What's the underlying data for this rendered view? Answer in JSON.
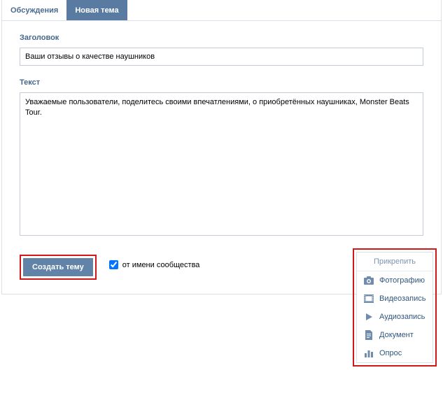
{
  "tabs": {
    "discussions": "Обсуждения",
    "new_topic": "Новая тема"
  },
  "form": {
    "title_label": "Заголовок",
    "title_value": "Ваши отзывы о качестве наушников",
    "text_label": "Текст",
    "text_value": "Уважаемые пользователи, поделитесь своими впечатлениями, о приобретённых наушниках, Monster Beats Tour."
  },
  "actions": {
    "create_button": "Создать тему",
    "community_checkbox_label": "от имени сообщества",
    "community_checkbox_checked": true
  },
  "attach": {
    "header": "Прикрепить",
    "items": [
      {
        "icon": "camera-icon",
        "label": "Фотографию"
      },
      {
        "icon": "film-icon",
        "label": "Видеозапись"
      },
      {
        "icon": "play-icon",
        "label": "Аудиозапись"
      },
      {
        "icon": "document-icon",
        "label": "Документ"
      },
      {
        "icon": "poll-icon",
        "label": "Опрос"
      }
    ]
  },
  "colors": {
    "accent": "#597ba2",
    "link": "#30557e",
    "highlight": "#d11818"
  }
}
